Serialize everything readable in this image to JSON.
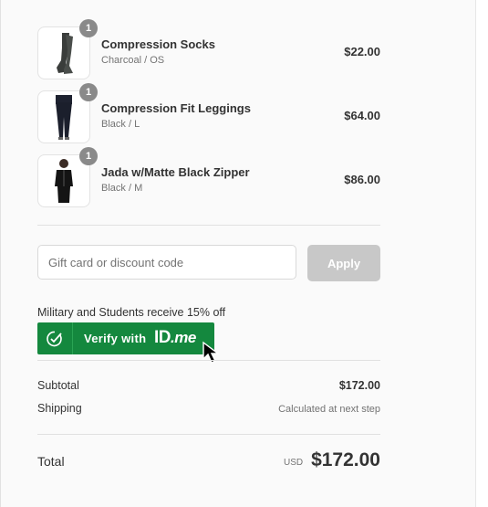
{
  "items": [
    {
      "title": "Compression Socks",
      "variant": "Charcoal / OS",
      "price": "$22.00",
      "qty": "1",
      "image": "socks-image"
    },
    {
      "title": "Compression Fit Leggings",
      "variant": "Black / L",
      "price": "$64.00",
      "qty": "1",
      "image": "leggings-image"
    },
    {
      "title": "Jada w/Matte Black Zipper",
      "variant": "Black / M",
      "price": "$86.00",
      "qty": "1",
      "image": "jacket-image"
    }
  ],
  "discount": {
    "placeholder": "Gift card or discount code",
    "value": "",
    "apply_label": "Apply"
  },
  "military": {
    "text": "Military and Students receive 15% off",
    "verify_label": "Verify with",
    "logo_id": "ID",
    "logo_me": ".me"
  },
  "summary": {
    "subtotal_label": "Subtotal",
    "subtotal_value": "$172.00",
    "shipping_label": "Shipping",
    "shipping_value": "Calculated at next step"
  },
  "total": {
    "label": "Total",
    "currency": "USD",
    "value": "$172.00"
  },
  "colors": {
    "verify_green": "#14883e",
    "apply_disabled": "#c8c8c8",
    "qty_badge": "#8a8a8a"
  }
}
